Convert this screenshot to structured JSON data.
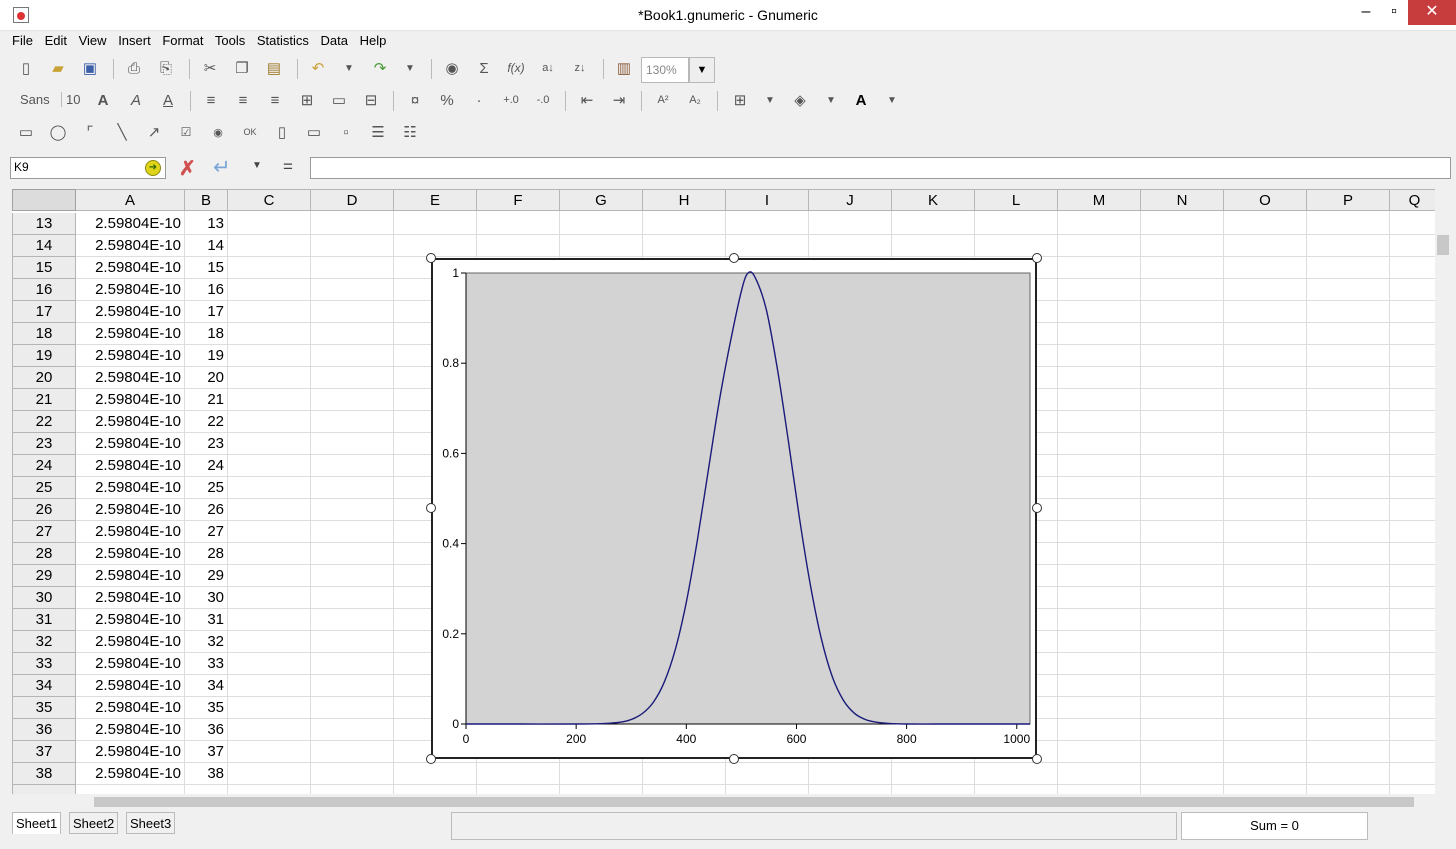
{
  "window": {
    "title": "*Book1.gnumeric - Gnumeric"
  },
  "menu": [
    "File",
    "Edit",
    "View",
    "Insert",
    "Format",
    "Tools",
    "Statistics",
    "Data",
    "Help"
  ],
  "toolbar": {
    "zoom": "130%",
    "font_name": "Sans",
    "font_size": "10"
  },
  "editbar": {
    "cell_ref": "K9",
    "formula_value": ""
  },
  "columns": [
    "A",
    "B",
    "C",
    "D",
    "E",
    "F",
    "G",
    "H",
    "I",
    "J",
    "K",
    "L",
    "M",
    "N",
    "O",
    "P",
    "Q"
  ],
  "rows": [
    {
      "num": "13",
      "a": "2.59804E-10",
      "b": "13"
    },
    {
      "num": "14",
      "a": "2.59804E-10",
      "b": "14"
    },
    {
      "num": "15",
      "a": "2.59804E-10",
      "b": "15"
    },
    {
      "num": "16",
      "a": "2.59804E-10",
      "b": "16"
    },
    {
      "num": "17",
      "a": "2.59804E-10",
      "b": "17"
    },
    {
      "num": "18",
      "a": "2.59804E-10",
      "b": "18"
    },
    {
      "num": "19",
      "a": "2.59804E-10",
      "b": "19"
    },
    {
      "num": "20",
      "a": "2.59804E-10",
      "b": "20"
    },
    {
      "num": "21",
      "a": "2.59804E-10",
      "b": "21"
    },
    {
      "num": "22",
      "a": "2.59804E-10",
      "b": "22"
    },
    {
      "num": "23",
      "a": "2.59804E-10",
      "b": "23"
    },
    {
      "num": "24",
      "a": "2.59804E-10",
      "b": "24"
    },
    {
      "num": "25",
      "a": "2.59804E-10",
      "b": "25"
    },
    {
      "num": "26",
      "a": "2.59804E-10",
      "b": "26"
    },
    {
      "num": "27",
      "a": "2.59804E-10",
      "b": "27"
    },
    {
      "num": "28",
      "a": "2.59804E-10",
      "b": "28"
    },
    {
      "num": "29",
      "a": "2.59804E-10",
      "b": "29"
    },
    {
      "num": "30",
      "a": "2.59804E-10",
      "b": "30"
    },
    {
      "num": "31",
      "a": "2.59804E-10",
      "b": "31"
    },
    {
      "num": "32",
      "a": "2.59804E-10",
      "b": "32"
    },
    {
      "num": "33",
      "a": "2.59804E-10",
      "b": "33"
    },
    {
      "num": "34",
      "a": "2.59804E-10",
      "b": "34"
    },
    {
      "num": "35",
      "a": "2.59804E-10",
      "b": "35"
    },
    {
      "num": "36",
      "a": "2.59804E-10",
      "b": "36"
    },
    {
      "num": "37",
      "a": "2.59804E-10",
      "b": "37"
    },
    {
      "num": "38",
      "a": "2.59804E-10",
      "b": "38"
    }
  ],
  "sheets": [
    "Sheet1",
    "Sheet2",
    "Sheet3"
  ],
  "status": {
    "sum": "Sum = 0"
  },
  "chart_data": {
    "type": "line",
    "title": "",
    "xlabel": "",
    "ylabel": "",
    "xlim": [
      0,
      1024
    ],
    "ylim": [
      0,
      1
    ],
    "x_ticks": [
      "0",
      "200",
      "400",
      "600",
      "800",
      "1000"
    ],
    "y_ticks": [
      "0",
      "0.2",
      "0.4",
      "0.6",
      "0.8",
      "1"
    ],
    "series": [
      {
        "color": "#1a1a7a",
        "x": [
          0,
          100,
          200,
          250,
          280,
          300,
          320,
          340,
          360,
          380,
          400,
          420,
          440,
          460,
          480,
          500,
          512,
          525,
          545,
          565,
          585,
          605,
          625,
          645,
          665,
          685,
          705,
          725,
          745,
          770,
          800,
          850,
          900,
          1024
        ],
        "y": [
          0,
          0,
          0,
          0.001,
          0.004,
          0.01,
          0.023,
          0.048,
          0.093,
          0.165,
          0.27,
          0.407,
          0.563,
          0.717,
          0.847,
          0.96,
          1,
          0.99,
          0.92,
          0.79,
          0.63,
          0.46,
          0.31,
          0.19,
          0.105,
          0.053,
          0.024,
          0.01,
          0.004,
          0.001,
          0,
          0,
          0,
          0
        ]
      }
    ],
    "plot_background": "#d3d3d3",
    "grid": false
  }
}
